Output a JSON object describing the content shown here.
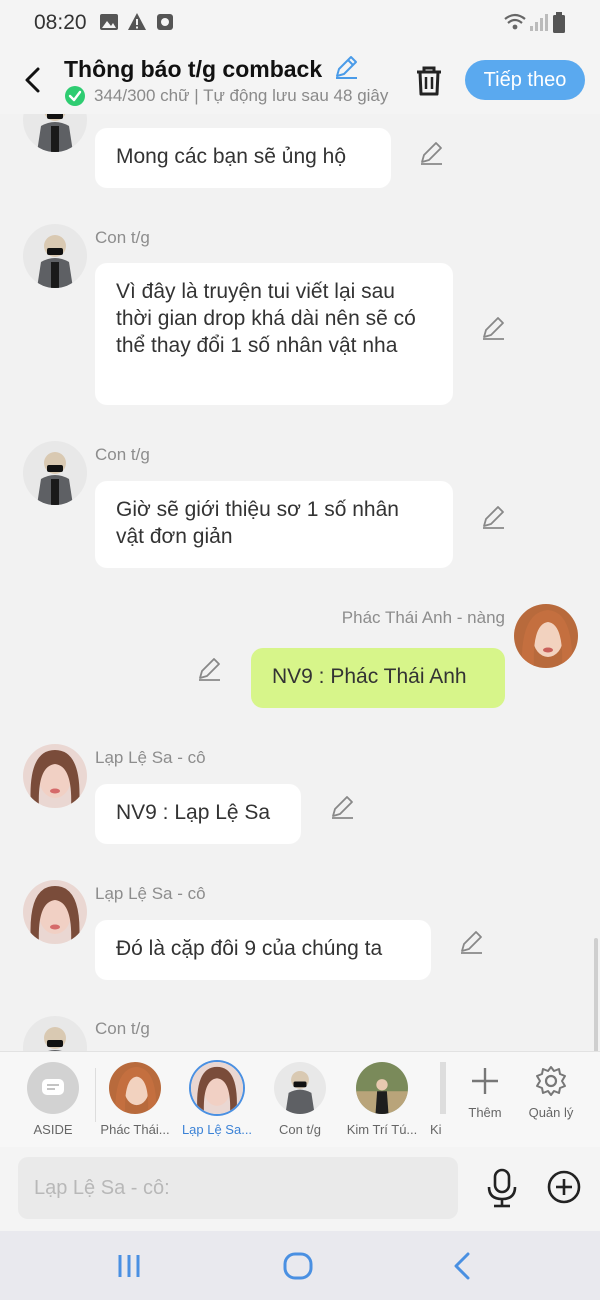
{
  "status": {
    "time": "08:20"
  },
  "header": {
    "title": "Thông báo t/g comback",
    "subtitle": "344/300 chữ | Tự động lưu sau 48 giây",
    "next_label": "Tiếp theo"
  },
  "messages": [
    {
      "sender": "",
      "text": "Mong các bạn sẽ ủng hộ",
      "side": "left"
    },
    {
      "sender": "Con t/g",
      "text": "Vì đây là truyện tui viết lại sau thời gian drop khá dài nên sẽ có thể thay đổi 1 số nhân vật nha",
      "side": "left"
    },
    {
      "sender": "Con t/g",
      "text": "Giờ sẽ giới thiệu sơ 1 số nhân vật đơn giản",
      "side": "left"
    },
    {
      "sender": "Phác Thái Anh - nàng",
      "text": "NV9 : Phác Thái Anh",
      "side": "right"
    },
    {
      "sender": "Lạp Lệ Sa - cô",
      "text": "NV9 : Lạp Lệ Sa",
      "side": "left"
    },
    {
      "sender": "Lạp Lệ Sa - cô",
      "text": "Đó là cặp đôi 9 của chúng ta",
      "side": "left"
    },
    {
      "sender": "Con t/g",
      "text": "",
      "side": "left"
    }
  ],
  "characters": [
    {
      "label": "ASIDE"
    },
    {
      "label": "Phác Thái..."
    },
    {
      "label": "Lạp Lệ Sa..."
    },
    {
      "label": "Con t/g"
    },
    {
      "label": "Kim Trí Tú..."
    },
    {
      "label": "Ki"
    }
  ],
  "tools": {
    "add_label": "Thêm",
    "manage_label": "Quản lý"
  },
  "input": {
    "placeholder": "Lạp Lệ Sa - cô:"
  },
  "colors": {
    "accent": "#5aa9ef",
    "my_bubble": "#d7f58a",
    "check_green": "#2ecc71"
  }
}
